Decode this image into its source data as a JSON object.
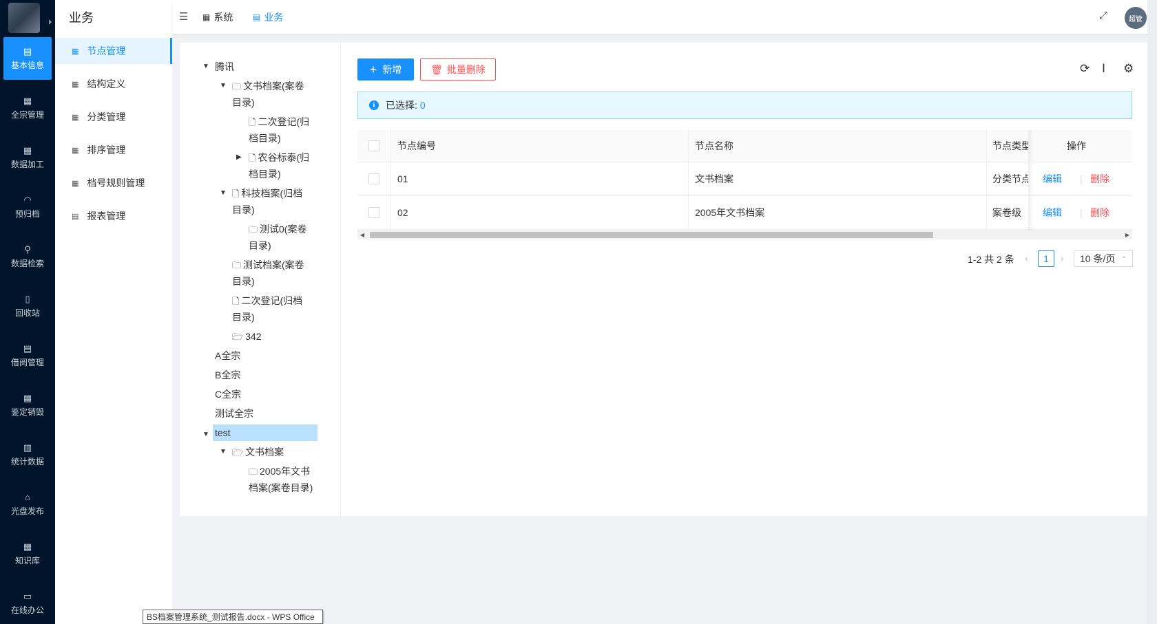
{
  "rail": {
    "items": [
      {
        "label": "基本信息",
        "icon": "▤"
      },
      {
        "label": "全宗管理",
        "icon": "▦"
      },
      {
        "label": "数据加工",
        "icon": "▦"
      },
      {
        "label": "预归档",
        "icon": "◠"
      },
      {
        "label": "数据检索",
        "icon": "⚲"
      },
      {
        "label": "回收站",
        "icon": "▯"
      },
      {
        "label": "借阅管理",
        "icon": "▤"
      },
      {
        "label": "鉴定销毁",
        "icon": "▦"
      },
      {
        "label": "统计数据",
        "icon": "▥"
      },
      {
        "label": "光盘发布",
        "icon": "⌂"
      },
      {
        "label": "知识库",
        "icon": "▦"
      },
      {
        "label": "在线办公",
        "icon": "▭"
      }
    ]
  },
  "sub": {
    "title": "业务",
    "items": [
      {
        "label": "节点管理",
        "icon": "▦"
      },
      {
        "label": "结构定义",
        "icon": "▦"
      },
      {
        "label": "分类管理",
        "icon": "▦"
      },
      {
        "label": "排序管理",
        "icon": "▦"
      },
      {
        "label": "档号规则管理",
        "icon": "▦"
      },
      {
        "label": "报表管理",
        "icon": "▤"
      }
    ]
  },
  "topbar": {
    "tabs": [
      {
        "label": "系统",
        "icon": "▦"
      },
      {
        "label": "业务",
        "icon": "▤"
      }
    ],
    "avatar": "超管"
  },
  "tree": [
    {
      "text": "腾讯"
    },
    {
      "text": "文书档案(案卷"
    },
    {
      "text": "目录)"
    },
    {
      "text": "二次登记(归"
    },
    {
      "text": "档目录)"
    },
    {
      "text": "农谷标泰(归"
    },
    {
      "text": "档目录)"
    },
    {
      "text": "科技档案(归档"
    },
    {
      "text": "目录)"
    },
    {
      "text": "测试0(案卷"
    },
    {
      "text": "目录)"
    },
    {
      "text": "测试档案(案卷"
    },
    {
      "text": "目录)"
    },
    {
      "text": "二次登记(归档"
    },
    {
      "text": "目录)"
    },
    {
      "text": "342"
    },
    {
      "text": "A全宗"
    },
    {
      "text": "B全宗"
    },
    {
      "text": "C全宗"
    },
    {
      "text": "测试全宗"
    },
    {
      "text": "test"
    },
    {
      "text": "文书档案"
    },
    {
      "text": "2005年文书"
    },
    {
      "text": "档案(案卷目录)"
    }
  ],
  "toolbar": {
    "add": "新增",
    "batch_delete": "批量删除"
  },
  "alert": {
    "label": "已选择:",
    "count": "0"
  },
  "table": {
    "headers": [
      "节点编号",
      "节点名称",
      "节点类型",
      "操作"
    ],
    "rows": [
      {
        "code": "01",
        "name": "文书档案",
        "type": "分类节点",
        "edit": "编辑",
        "del": "删除"
      },
      {
        "code": "02",
        "name": "2005年文书档案",
        "type": "案卷级",
        "edit": "编辑",
        "del": "删除"
      }
    ]
  },
  "pagination": {
    "total": "1-2 共 2 条",
    "current": "1",
    "page_size": "10 条/页"
  },
  "taskbar_tip": "BS档案管理系统_测试报告.docx - WPS Office",
  "colors": {
    "primary": "#1890ff",
    "danger": "#ff4d4f",
    "rail_bg": "#001529"
  }
}
